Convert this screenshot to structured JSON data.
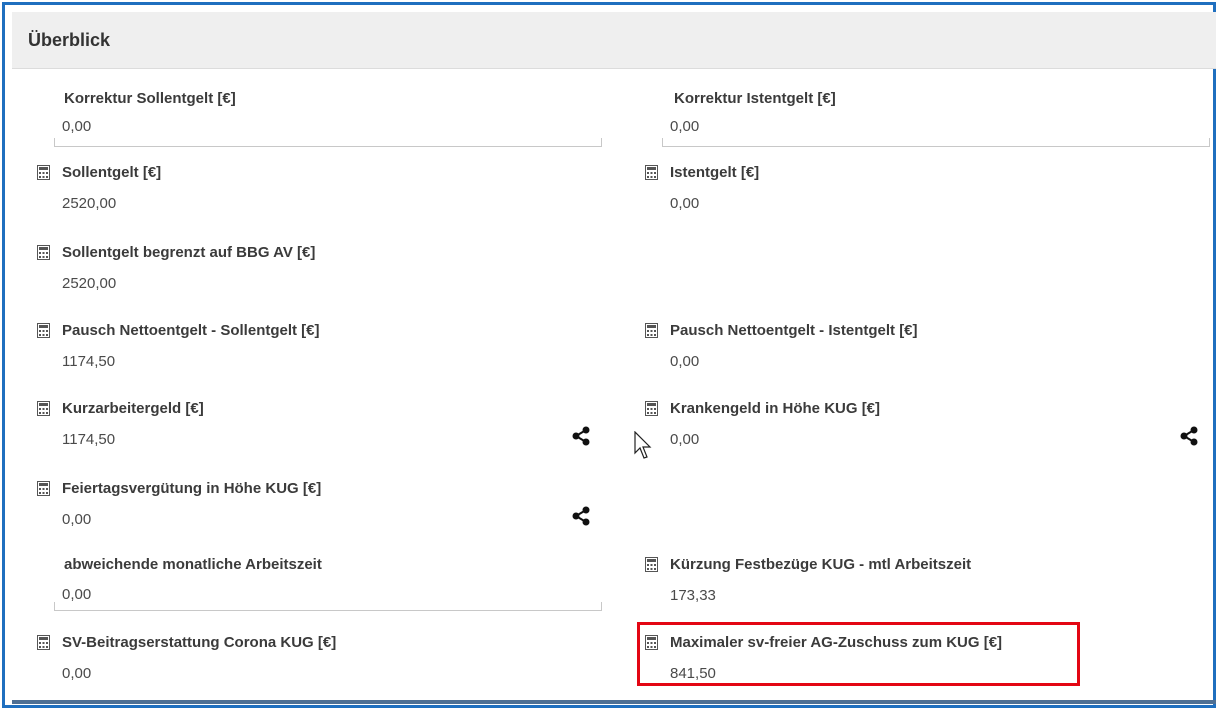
{
  "panel": {
    "title": "Überblick"
  },
  "fields": {
    "korrektur_soll": {
      "label": "Korrektur Sollentgelt [€]",
      "value": "0,00"
    },
    "korrektur_ist": {
      "label": "Korrektur Istentgelt [€]",
      "value": "0,00"
    },
    "sollentgelt": {
      "label": "Sollentgelt [€]",
      "value": "2520,00"
    },
    "istentgelt": {
      "label": "Istentgelt [€]",
      "value": "0,00"
    },
    "soll_bbg": {
      "label": "Sollentgelt begrenzt auf BBG AV [€]",
      "value": "2520,00"
    },
    "pausch_soll": {
      "label": "Pausch Nettoentgelt - Sollentgelt [€]",
      "value": "1174,50"
    },
    "pausch_ist": {
      "label": "Pausch Nettoentgelt - Istentgelt [€]",
      "value": "0,00"
    },
    "kurzarbeitergeld": {
      "label": "Kurzarbeitergeld [€]",
      "value": "1174,50"
    },
    "krankengeld": {
      "label": "Krankengeld in Höhe KUG [€]",
      "value": "0,00"
    },
    "feiertag": {
      "label": "Feiertagsvergütung in Höhe KUG [€]",
      "value": "0,00"
    },
    "abw_arbeitszeit": {
      "label": "abweichende monatliche Arbeitszeit",
      "value": "0,00"
    },
    "kuerzung": {
      "label": "Kürzung Festbezüge KUG - mtl Arbeitszeit",
      "value": "173,33"
    },
    "sv_beitrag": {
      "label": "SV-Beitragserstattung Corona KUG [€]",
      "value": "0,00"
    },
    "max_zuschuss": {
      "label": "Maximaler sv-freier AG-Zuschuss zum KUG [€]",
      "value": "841,50"
    }
  },
  "icons": {
    "calculator": "calculator-icon",
    "share": "share-icon",
    "cursor": "mouse-cursor"
  },
  "colors": {
    "highlight": "#e30613",
    "frame": "#1f6fbf"
  }
}
